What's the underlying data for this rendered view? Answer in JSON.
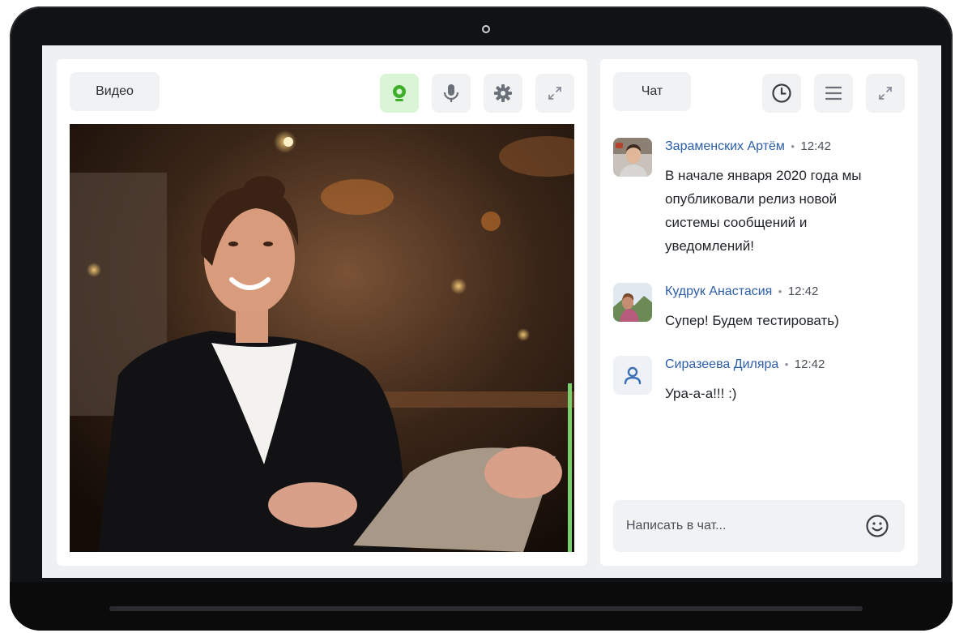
{
  "video": {
    "title": "Видео",
    "tools": [
      {
        "icon": "webcam-icon",
        "active": true
      },
      {
        "icon": "microphone-icon"
      },
      {
        "icon": "gear-icon"
      },
      {
        "icon": "expand-icon"
      }
    ],
    "accent_color": "#3fae2a"
  },
  "chat": {
    "title": "Чат",
    "tools": [
      {
        "icon": "clock-icon"
      },
      {
        "icon": "menu-icon"
      },
      {
        "icon": "expand-icon"
      }
    ],
    "messages": [
      {
        "author": "Зараменских Артём",
        "separator": "•",
        "time": "12:42",
        "text": "В начале января 2020 года мы опубликовали релиз новой системы сообщений и уведомлений!",
        "avatar": "photo-avatar"
      },
      {
        "author": "Кудрук Анастасия",
        "separator": "•",
        "time": "12:42",
        "text": "Супер! Будем тестировать)",
        "avatar": "photo-avatar"
      },
      {
        "author": "Сиразеева Диляра",
        "separator": "•",
        "time": "12:42",
        "text": "Ура-а-а!!! :)",
        "avatar": "user-icon"
      }
    ],
    "input": {
      "placeholder": "Написать в чат...",
      "value": ""
    },
    "author_color": "#2d5ea8"
  }
}
